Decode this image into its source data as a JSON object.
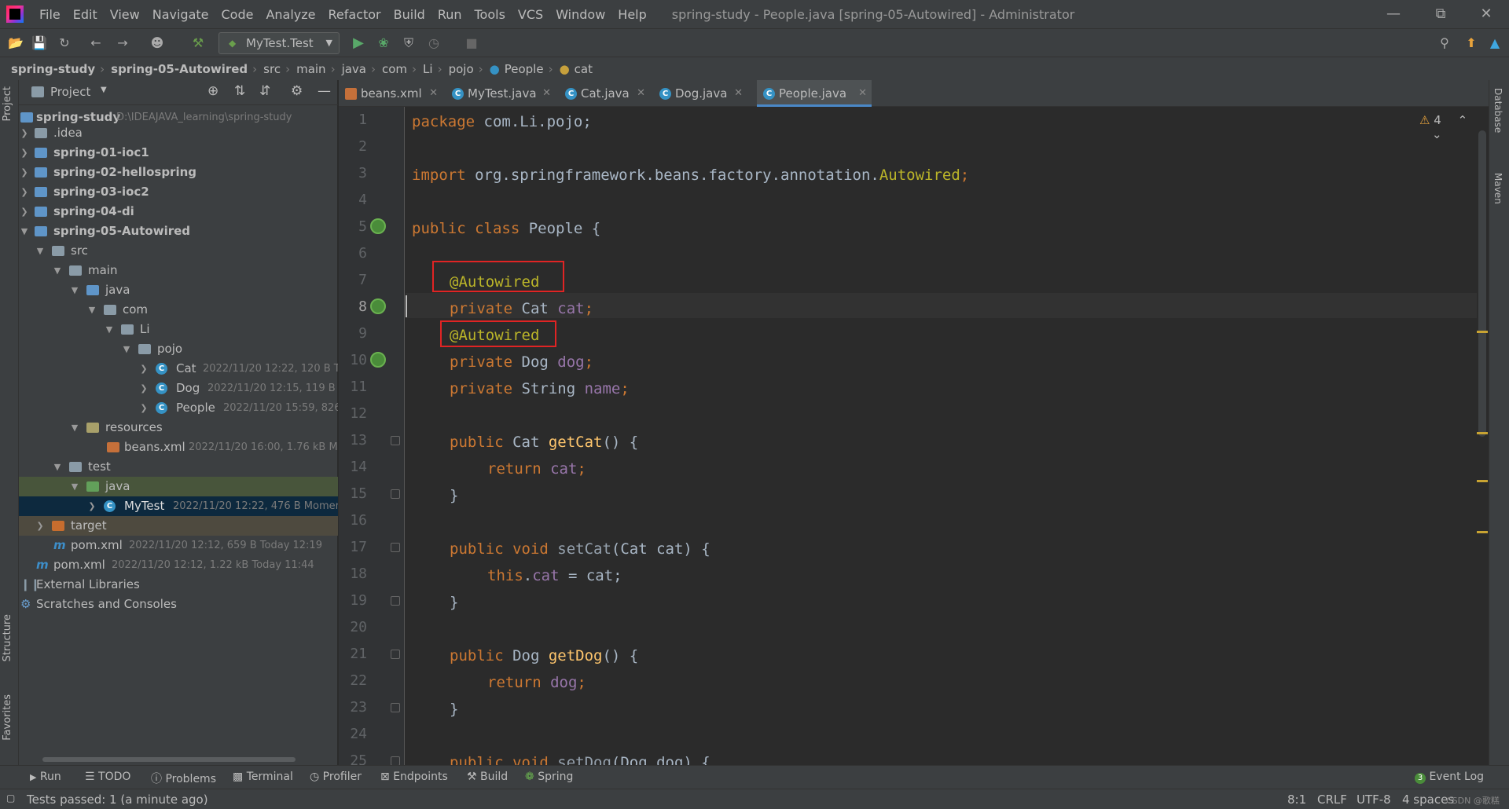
{
  "menu": [
    "File",
    "Edit",
    "View",
    "Navigate",
    "Code",
    "Analyze",
    "Refactor",
    "Build",
    "Run",
    "Tools",
    "VCS",
    "Window",
    "Help"
  ],
  "window_title": "spring-study - People.java [spring-05-Autowired] - Administrator",
  "run_config": "MyTest.Test",
  "breadcrumb": [
    "spring-study",
    "spring-05-Autowired",
    "src",
    "main",
    "java",
    "com",
    "Li",
    "pojo",
    "People",
    "cat"
  ],
  "project_panel": {
    "title": "Project",
    "tree": [
      {
        "label": "spring-study",
        "meta": "D:\\IDEAJAVA_learning\\spring-study"
      },
      {
        "label": ".idea",
        "meta": ""
      },
      {
        "label": "spring-01-ioc1",
        "meta": ""
      },
      {
        "label": "spring-02-hellospring",
        "meta": ""
      },
      {
        "label": "spring-03-ioc2",
        "meta": ""
      },
      {
        "label": "spring-04-di",
        "meta": ""
      },
      {
        "label": "spring-05-Autowired",
        "meta": ""
      },
      {
        "label": "src",
        "meta": ""
      },
      {
        "label": "main",
        "meta": ""
      },
      {
        "label": "java",
        "meta": ""
      },
      {
        "label": "com",
        "meta": ""
      },
      {
        "label": "Li",
        "meta": ""
      },
      {
        "label": "pojo",
        "meta": ""
      },
      {
        "label": "Cat",
        "meta": "2022/11/20 12:22, 120 B To"
      },
      {
        "label": "Dog",
        "meta": "2022/11/20 12:15, 119 B T"
      },
      {
        "label": "People",
        "meta": "2022/11/20 15:59, 826"
      },
      {
        "label": "resources",
        "meta": ""
      },
      {
        "label": "beans.xml",
        "meta": "2022/11/20 16:00, 1.76 kB Mc"
      },
      {
        "label": "test",
        "meta": ""
      },
      {
        "label": "java",
        "meta": ""
      },
      {
        "label": "MyTest",
        "meta": "2022/11/20 12:22, 476 B Momen"
      },
      {
        "label": "target",
        "meta": ""
      },
      {
        "label": "pom.xml",
        "meta": "2022/11/20 12:12, 659 B Today 12:19"
      },
      {
        "label": "pom.xml",
        "meta": "2022/11/20 12:12, 1.22 kB Today 11:44"
      },
      {
        "label": "External Libraries",
        "meta": ""
      },
      {
        "label": "Scratches and Consoles",
        "meta": ""
      }
    ]
  },
  "tabs": [
    "beans.xml",
    "MyTest.java",
    "Cat.java",
    "Dog.java",
    "People.java"
  ],
  "warnings_count": "4",
  "code": {
    "l1a": "package",
    "l1b": " com.Li.pojo;",
    "l3a": "import",
    "l3b": " org.springframework.beans.factory.annotation.",
    "l3c": "Autowired",
    "l3d": ";",
    "l5a": "public class",
    "l5b": " People {",
    "ann": "@Autowired",
    "priv": "private",
    "l8b": " Cat ",
    "l8c": "cat",
    "semi": ";",
    "l10b": " Dog ",
    "l10c": "dog",
    "l11b": " String ",
    "l11c": "name",
    "pub": "public",
    "l13b": " Cat ",
    "l13c": "getCat",
    "l13d": "() {",
    "ret": "return",
    "l14b": " ",
    "l14c": "cat",
    "close": "}",
    "void": " void ",
    "l17c": "setCat",
    "l17d": "(Cat cat) {",
    "this": "this",
    "l18b": ".",
    "l18c": "cat",
    "l18d": " = cat;",
    "l21b": " Dog ",
    "l21c": "getDog",
    "l22c": "dog",
    "l25c": "setDog",
    "l25d": "(Dog dog) {"
  },
  "line_numbers": [
    "1",
    "2",
    "3",
    "4",
    "5",
    "6",
    "7",
    "8",
    "9",
    "10",
    "11",
    "12",
    "13",
    "14",
    "15",
    "16",
    "17",
    "18",
    "19",
    "20",
    "21",
    "22",
    "23",
    "24",
    "25"
  ],
  "right_tools": [
    "Database",
    "Maven"
  ],
  "left_tools": [
    "Project",
    "Structure",
    "Favorites"
  ],
  "bottom_tools": [
    "Run",
    "TODO",
    "Problems",
    "Terminal",
    "Profiler",
    "Endpoints",
    "Build",
    "Spring"
  ],
  "event_log": "Event Log",
  "event_count": "3",
  "status": {
    "message": "Tests passed: 1 (a minute ago)",
    "position": "8:1",
    "line_sep": "CRLF",
    "encoding": "UTF-8",
    "indent": "4 spaces",
    "watermark": "CSDN @歌糕"
  },
  "colors": {
    "keyword": "#cc7832",
    "annotation": "#bbb529",
    "field": "#9876aa",
    "method": "#ffc66d",
    "highlight_box": "#e02424"
  }
}
